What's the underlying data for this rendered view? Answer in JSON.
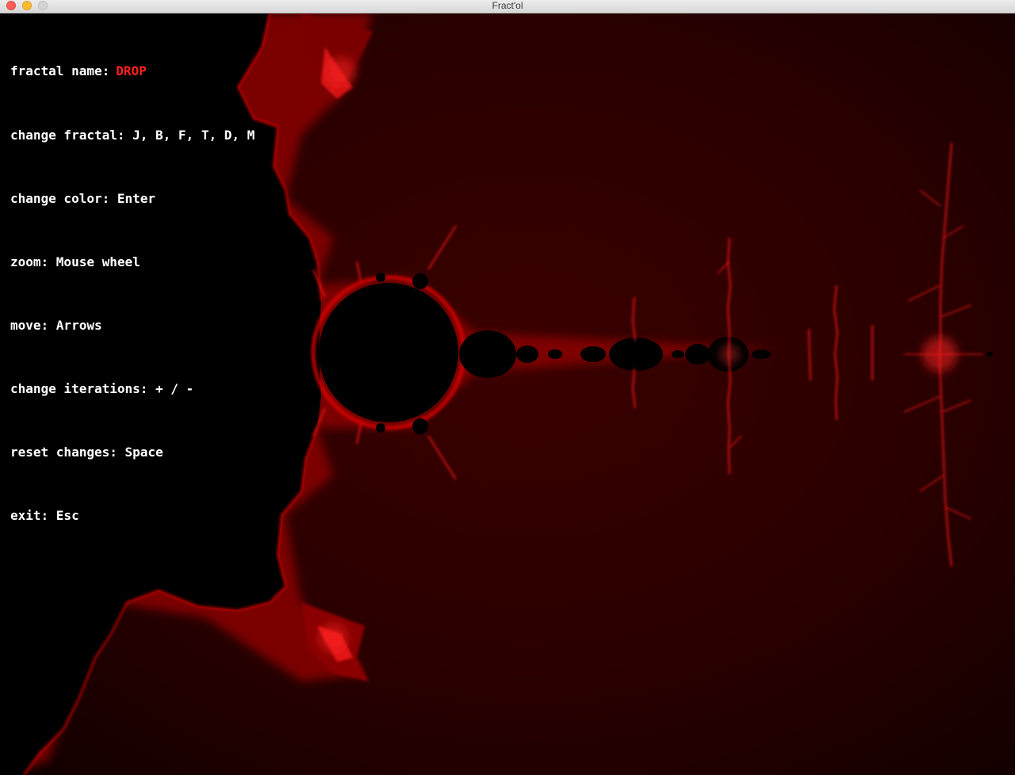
{
  "window": {
    "title": "Fract'ol"
  },
  "hud": {
    "fractal_name_label": "fractal name:",
    "fractal_name_value": "DROP",
    "lines": [
      "change fractal: J, B, F, T, D, M",
      "change color: Enter",
      "zoom: Mouse wheel",
      "move: Arrows",
      "change iterations: + / -",
      "reset changes: Space",
      "exit: Esc"
    ]
  },
  "colors": {
    "background": "#1a0000",
    "set_fill": "#000000",
    "glow": "#ff1a1a",
    "hud_text": "#ffffff",
    "hud_accent": "#ff2020"
  }
}
